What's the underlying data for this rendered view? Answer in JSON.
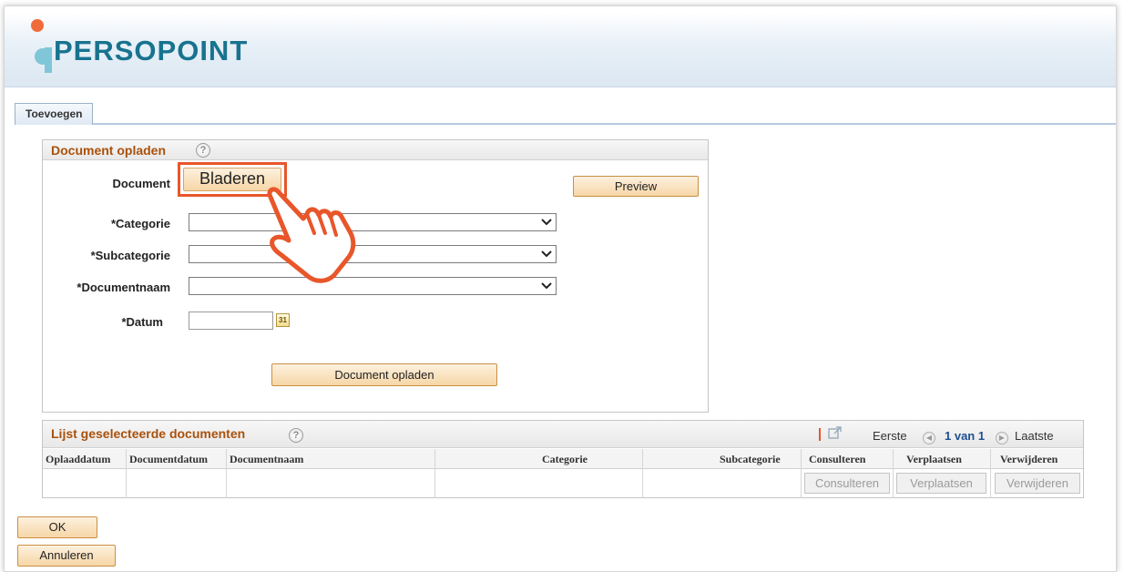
{
  "app": {
    "logo_text": "PERSOPOINT"
  },
  "tabs": [
    "Toevoegen"
  ],
  "upload": {
    "title": "Document opladen",
    "help_icon": "?",
    "document_label": "Document",
    "browse_button": "Bladeren",
    "preview_button": "Preview",
    "categorie_label": "*Categorie",
    "subcategorie_label": "*Subcategorie",
    "documentnaam_label": "*Documentnaam",
    "datum_label": "*Datum",
    "calendar_text": "31",
    "upload_button": "Document opladen"
  },
  "list": {
    "title": "Lijst geselecteerde documenten",
    "help_icon": "?",
    "nav": {
      "first": "Eerste",
      "page": "1 van 1",
      "last": "Laatste"
    },
    "columns": [
      "Oplaaddatum",
      "Documentdatum",
      "Documentnaam",
      "Categorie",
      "Subcategorie",
      "Consulteren",
      "Verplaatsen",
      "Verwijderen"
    ],
    "row_buttons": [
      "Consulteren",
      "Verplaatsen",
      "Verwijderen"
    ]
  },
  "footer": {
    "ok_button": "OK",
    "cancel_button": "Annuleren"
  },
  "colors": {
    "accent_orange": "#e8562a",
    "title_brown": "#a9510b",
    "logo_teal": "#18738f",
    "logo_dot": "#f06b3b"
  }
}
